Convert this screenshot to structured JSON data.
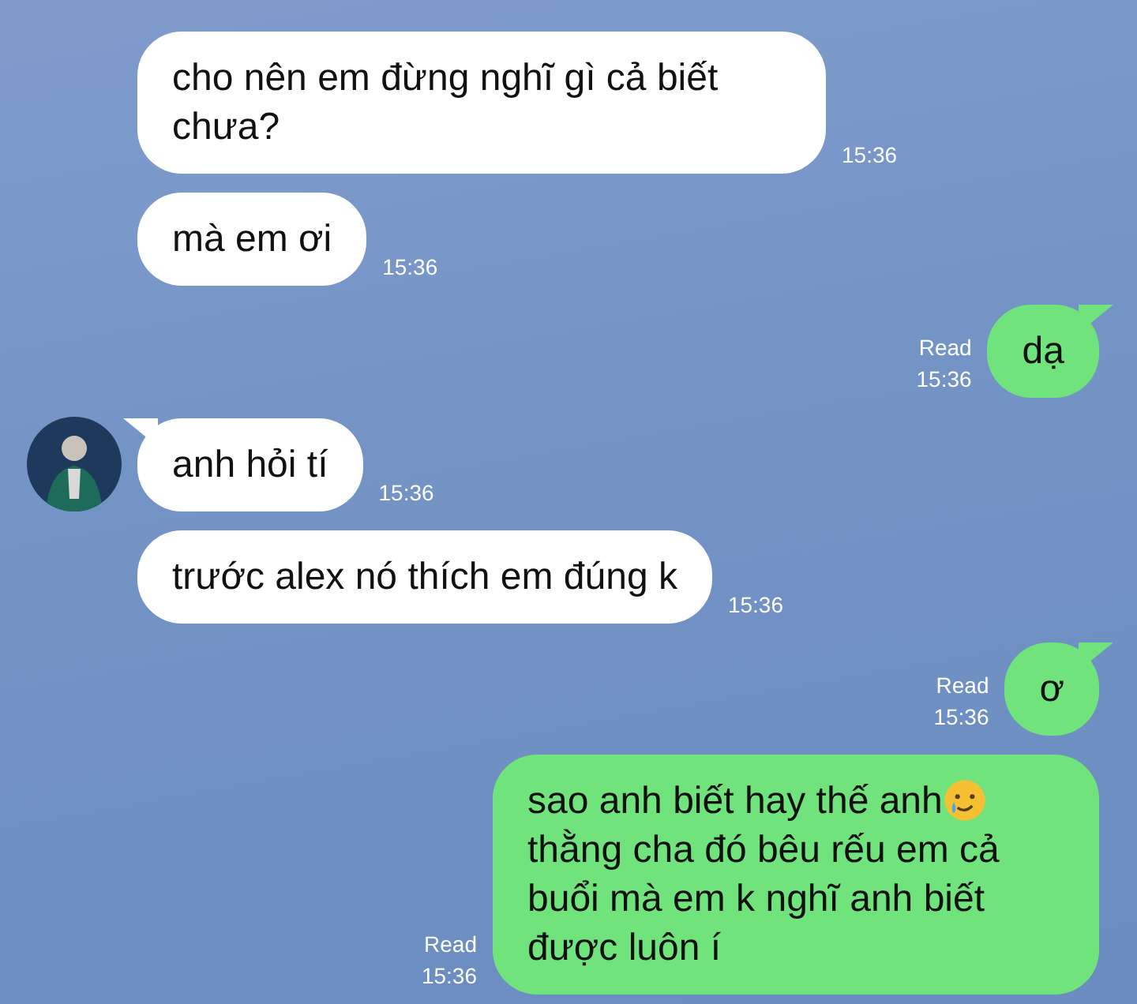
{
  "messages": [
    {
      "kind": "incoming",
      "avatar": false,
      "tail": false,
      "parts": [
        {
          "kind": "text",
          "text": "cho nên em đừng nghĩ gì cả biết chưa?"
        }
      ],
      "time": "15:36"
    },
    {
      "kind": "incoming",
      "avatar": false,
      "tail": false,
      "parts": [
        {
          "kind": "text",
          "text": "mà em ơi"
        }
      ],
      "time": "15:36"
    },
    {
      "kind": "outgoing",
      "tail": true,
      "parts": [
        {
          "kind": "text",
          "text": "dạ"
        }
      ],
      "read": "Read",
      "time": "15:36"
    },
    {
      "kind": "incoming",
      "avatar": true,
      "tail": true,
      "parts": [
        {
          "kind": "text",
          "text": "anh hỏi tí"
        }
      ],
      "time": "15:36"
    },
    {
      "kind": "incoming",
      "avatar": false,
      "tail": false,
      "parts": [
        {
          "kind": "text",
          "text": "trước alex nó thích em đúng k"
        }
      ],
      "time": "15:36"
    },
    {
      "kind": "outgoing",
      "tail": true,
      "parts": [
        {
          "kind": "text",
          "text": "ơ"
        }
      ],
      "read": "Read",
      "time": "15:36"
    },
    {
      "kind": "outgoing",
      "tail": false,
      "parts": [
        {
          "kind": "text",
          "text": "sao anh biết hay thế anh"
        },
        {
          "kind": "emoji"
        },
        {
          "kind": "text",
          "text": "thằng cha đó bêu rếu em cả buổi mà em k nghĩ anh biết được luôn í"
        }
      ],
      "read": "Read",
      "time": "15:36"
    }
  ]
}
